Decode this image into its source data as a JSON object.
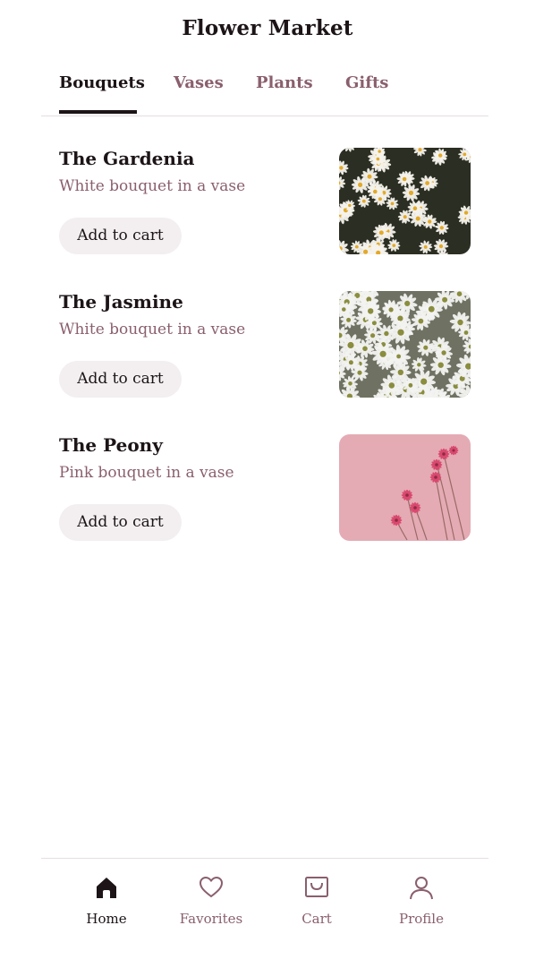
{
  "header": {
    "title": "Flower Market"
  },
  "tabs": [
    {
      "label": "Bouquets",
      "active": true
    },
    {
      "label": "Vases",
      "active": false
    },
    {
      "label": "Plants",
      "active": false
    },
    {
      "label": "Gifts",
      "active": false
    }
  ],
  "products": [
    {
      "name": "The Gardenia",
      "description": "White bouquet in a vase",
      "button_label": "Add to cart",
      "image": "white-daisies-dark-photo"
    },
    {
      "name": "The Jasmine",
      "description": "White bouquet in a vase",
      "button_label": "Add to cart",
      "image": "white-daisies-photo"
    },
    {
      "name": "The Peony",
      "description": "Pink bouquet in a vase",
      "button_label": "Add to cart",
      "image": "pink-flowers-on-pink-photo"
    }
  ],
  "bottom_nav": [
    {
      "label": "Home",
      "icon": "home-icon",
      "active": true
    },
    {
      "label": "Favorites",
      "icon": "heart-icon",
      "active": false
    },
    {
      "label": "Cart",
      "icon": "shopping-bag-icon",
      "active": false
    },
    {
      "label": "Profile",
      "icon": "user-icon",
      "active": false
    }
  ],
  "colors": {
    "text_primary": "#1c1416",
    "text_secondary": "#8a5f6d",
    "button_bg": "#f3eff0",
    "divider": "#e6dfe1",
    "peony_bg": "#e0a4ae",
    "peony_flower": "#d9486f"
  }
}
